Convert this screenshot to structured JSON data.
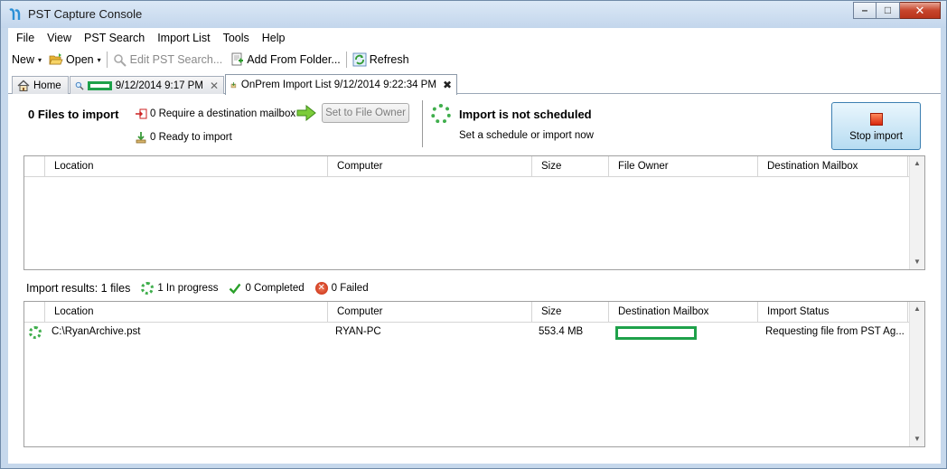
{
  "window": {
    "title": "PST Capture Console",
    "controls": {
      "minimize": "–",
      "maximize": "□",
      "close": "✕"
    }
  },
  "menu": [
    "File",
    "View",
    "PST Search",
    "Import List",
    "Tools",
    "Help"
  ],
  "toolbar": {
    "new_label": "New",
    "open_label": "Open",
    "edit_search_label": "Edit PST Search...",
    "add_folder_label": "Add From Folder...",
    "refresh_label": "Refresh",
    "dropdown_arrow": "▾"
  },
  "tabs": [
    {
      "label": "Home"
    },
    {
      "label": "9/12/2014 9:17 PM",
      "close": "✕"
    },
    {
      "label": "OnPrem Import List 9/12/2014 9:22:34 PM",
      "close": "✖"
    }
  ],
  "summary": {
    "files_title": "0 Files to import",
    "require_mailbox": "0 Require a destination mailbox",
    "ready": "0 Ready to import",
    "set_owner_button": "Set to File Owner",
    "schedule_title": "Import is not scheduled",
    "schedule_sub": "Set a schedule or import now",
    "stop_button": "Stop import"
  },
  "import_list": {
    "columns": [
      "",
      "Location",
      "Computer",
      "Size",
      "File Owner",
      "Destination Mailbox"
    ],
    "rows": []
  },
  "results": {
    "label": "Import results: 1 files",
    "in_progress": "1 In progress",
    "completed": "0 Completed",
    "failed": "0 Failed",
    "fail_glyph": "✕",
    "columns": [
      "Location",
      "Computer",
      "Size",
      "Destination Mailbox",
      "Import Status"
    ],
    "rows": [
      {
        "location": "C:\\RyanArchive.pst",
        "computer": "RYAN-PC",
        "size": "553.4 MB",
        "mailbox": "",
        "status": "Requesting file from PST Ag..."
      }
    ]
  },
  "scroll": {
    "up": "▲",
    "down": "▼"
  }
}
